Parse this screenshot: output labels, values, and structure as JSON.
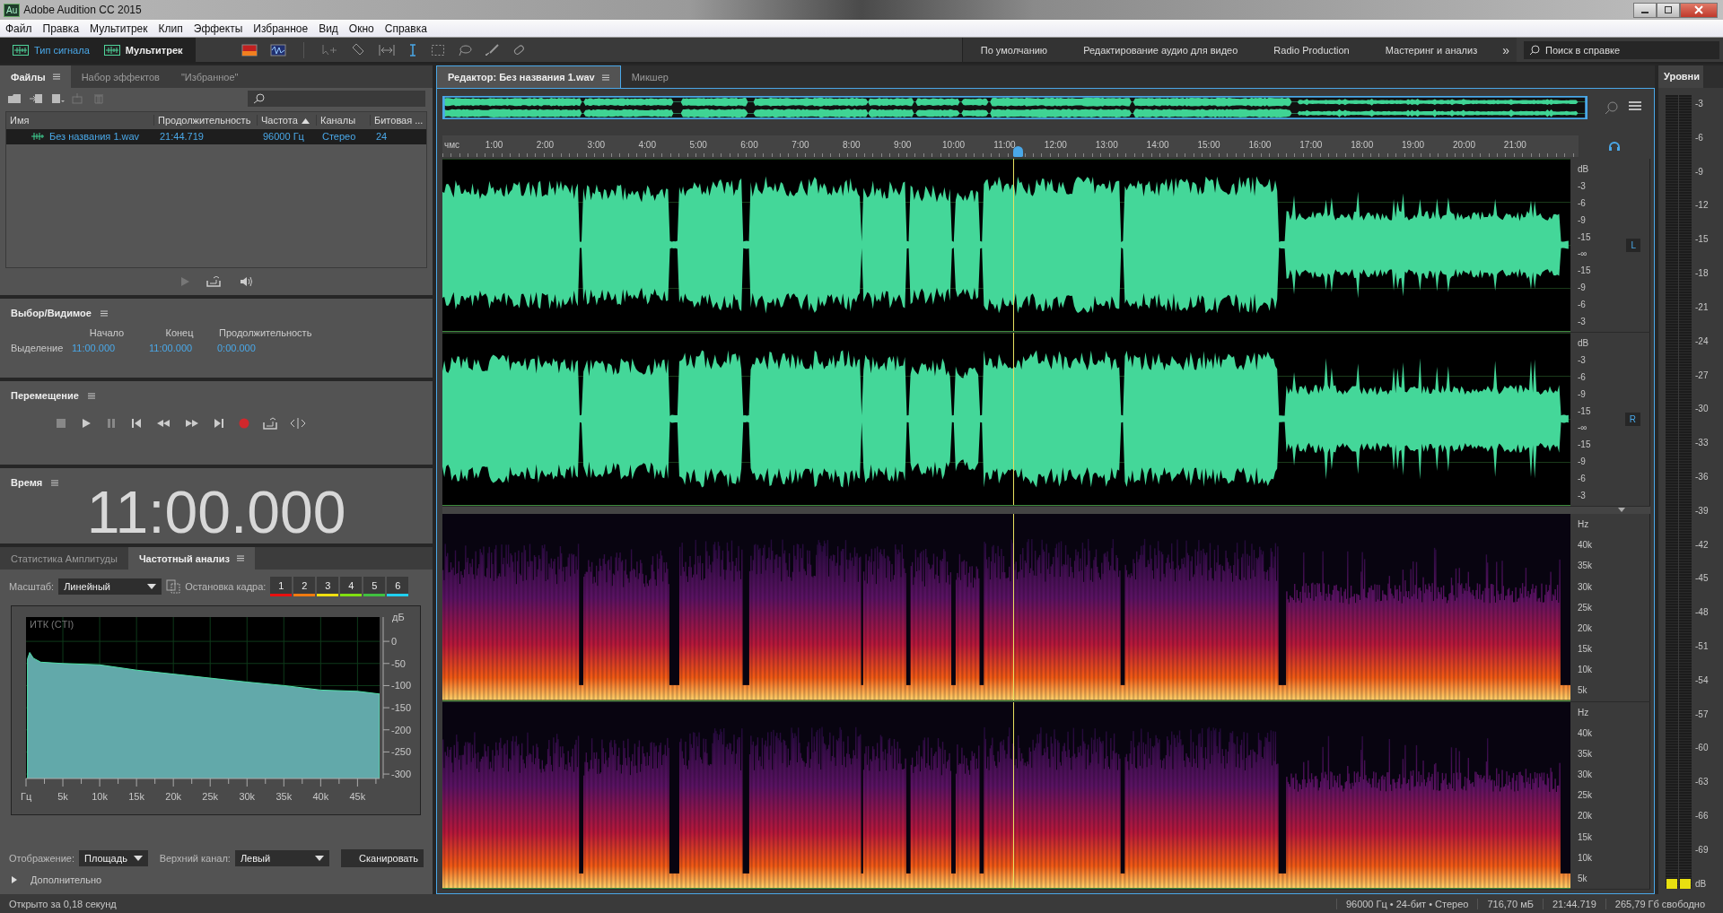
{
  "window": {
    "badge": "Au",
    "title": "Adobe Audition CC 2015"
  },
  "menu": [
    "Файл",
    "Правка",
    "Мультитрек",
    "Клип",
    "Эффекты",
    "Избранное",
    "Вид",
    "Окно",
    "Справка"
  ],
  "view_modes": [
    {
      "label": "Тип сигнала",
      "selected": true
    },
    {
      "label": "Мультитрек",
      "selected": false
    }
  ],
  "workspaces": [
    "По умолчанию",
    "Редактирование аудио для видео",
    "Radio Production",
    "Мастеринг и анализ"
  ],
  "more": "»",
  "help_search": {
    "placeholder": "Поиск в справке"
  },
  "files_panel": {
    "tabs": [
      {
        "label": "Файлы",
        "selected": true
      },
      {
        "label": "Набор эффектов",
        "selected": false
      },
      {
        "label": "\"Избранное\"",
        "selected": false
      }
    ],
    "columns": [
      "Имя",
      "Продолжительность",
      "Частота",
      "Каналы",
      "Битовая ..."
    ],
    "rows": [
      {
        "name": "Без названия 1.wav",
        "duration": "21:44.719",
        "rate": "96000 Гц",
        "channels": "Стерео",
        "bits": "24",
        "selected": true
      }
    ]
  },
  "selection_panel": {
    "title": "Выбор/Видимое",
    "columns": [
      "Начало",
      "Конец",
      "Продолжительность"
    ],
    "row_label": "Выделение",
    "values": [
      "11:00.000",
      "11:00.000",
      "0:00.000"
    ]
  },
  "transport_panel": {
    "title": "Перемещение"
  },
  "time_panel": {
    "title": "Время",
    "time": "11:00.000"
  },
  "analysis_panel": {
    "tabs": [
      {
        "label": "Статистика Амплитуды",
        "selected": false
      },
      {
        "label": "Частотный анализ",
        "selected": true
      }
    ],
    "scale_label": "Масштаб:",
    "scale": "Линейный",
    "freeze_label": "Остановка кадра:",
    "frames": [
      {
        "label": "1",
        "color": "#e81010"
      },
      {
        "label": "2",
        "color": "#f07a10"
      },
      {
        "label": "3",
        "color": "#f0e010"
      },
      {
        "label": "4",
        "color": "#80e010"
      },
      {
        "label": "5",
        "color": "#40c040"
      },
      {
        "label": "6",
        "color": "#20d0f0"
      }
    ],
    "chart_data": {
      "type": "area",
      "grid": true,
      "xlabel": "Гц",
      "ylabel": "дБ",
      "x": [
        200,
        500,
        1000,
        2000,
        5000,
        10000,
        15000,
        20000,
        25000,
        30000,
        35000,
        40000,
        45000,
        48000
      ],
      "series": [
        {
          "name": "ИТК (CTI)",
          "color": "#62a9aa",
          "values": [
            -40,
            -25,
            -38,
            -47,
            -50,
            -53,
            -65,
            -74,
            -83,
            -92,
            -100,
            -110,
            -113,
            -119
          ]
        }
      ],
      "xlim": [
        0,
        48000
      ],
      "ylim": [
        -310,
        55
      ],
      "xticks": [
        {
          "value": 5000,
          "label": "5k"
        },
        {
          "value": 10000,
          "label": "10k"
        },
        {
          "value": 15000,
          "label": "15k"
        },
        {
          "value": 20000,
          "label": "20k"
        },
        {
          "value": 25000,
          "label": "25k"
        },
        {
          "value": 30000,
          "label": "30k"
        },
        {
          "value": 35000,
          "label": "35k"
        },
        {
          "value": 40000,
          "label": "40k"
        },
        {
          "value": 45000,
          "label": "45k"
        }
      ],
      "yticks": [
        0,
        -50,
        -100,
        -150,
        -200,
        -250,
        -300
      ]
    },
    "display_label": "Отображение:",
    "display": "Площадь",
    "channel_label": "Верхний канал:",
    "channel": "Левый",
    "scan_button": "Сканировать",
    "advanced": {
      "label": "Дополнительно",
      "expanded": false
    }
  },
  "editor": {
    "tabs": [
      {
        "label": "Редактор: Без названия 1.wav",
        "selected": true
      },
      {
        "label": "Микшер",
        "selected": false
      }
    ],
    "playhead": {
      "level": 0.506
    },
    "ruler": [
      "чмс",
      "1:00",
      "2:00",
      "3:00",
      "4:00",
      "5:00",
      "6:00",
      "7:00",
      "8:00",
      "9:00",
      "10:00",
      "11:00",
      "12:00",
      "13:00",
      "14:00",
      "15:00",
      "16:00",
      "17:00",
      "18:00",
      "19:00",
      "20:00",
      "21:00"
    ],
    "channels": [
      {
        "badge": "L",
        "scale": [
          "dB",
          "-3",
          "-6",
          "-9",
          "-15",
          "-∞",
          "-15",
          "-9",
          "-6",
          "-3"
        ]
      },
      {
        "badge": "R",
        "scale": [
          "dB",
          "-3",
          "-6",
          "-9",
          "-15",
          "-∞",
          "-15",
          "-9",
          "-6",
          "-3"
        ]
      }
    ],
    "spectral_channels": [
      {
        "scale": [
          "Hz",
          "40k",
          "35k",
          "30k",
          "25k",
          "20k",
          "15k",
          "10k",
          "5k"
        ]
      },
      {
        "scale": [
          "Hz",
          "40k",
          "35k",
          "30k",
          "25k",
          "20k",
          "15k",
          "10k",
          "5k"
        ]
      }
    ]
  },
  "levels_panel": {
    "title": "Уровни",
    "scale": [
      "-3",
      "-6",
      "-9",
      "-12",
      "-15",
      "-18",
      "-21",
      "-24",
      "-27",
      "-30",
      "-33",
      "-36",
      "-39",
      "-42",
      "-45",
      "-48",
      "-51",
      "-54",
      "-57",
      "-60",
      "-63",
      "-66",
      "-69",
      "dB"
    ],
    "meters": [
      {
        "level": 0.012
      },
      {
        "level": 0.012
      }
    ]
  },
  "status_bar": {
    "message": "Открыто за 0,18 секунд",
    "items": [
      "96000 Гц • 24-бит • Стерео",
      "716,70 мБ",
      "21:44.719",
      "265,79 Гб свободно"
    ]
  }
}
